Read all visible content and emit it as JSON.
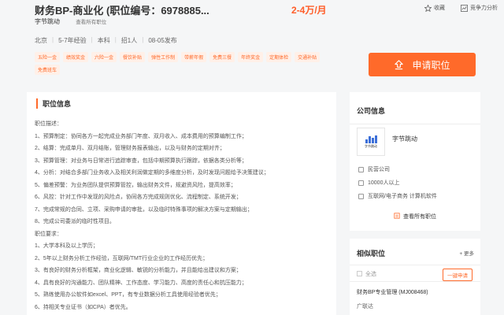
{
  "header": {
    "title": "财务BP-商业化 (职位编号：6978885...",
    "salary": "2-4万/月",
    "actions": [
      {
        "label": "收藏",
        "icon": "star-icon"
      },
      {
        "label": "竞争力分析",
        "icon": "analysis-icon"
      }
    ],
    "company": "字节跳动",
    "company_link": "查看所有职位",
    "meta": [
      "北京",
      "5-7年经验",
      "本科",
      "招1人",
      "08-05发布"
    ],
    "tags": [
      "五险一金",
      "绩效奖金",
      "六险一金",
      "餐饮补贴",
      "弹性工作制",
      "带薪年假",
      "免费三餐",
      "年终奖金",
      "定期体检",
      "交通补贴",
      "免费班车"
    ],
    "apply_label": "申请职位"
  },
  "job": {
    "section_title": "职位信息",
    "lines": [
      "职位描述：",
      "1、预算制定：协同各方一起完成业务部门年度、双月收入、成本费用的预算编制工作；",
      "2、结算：完成单月、双月结账，管理财务报表输出，以及与财务的定期对齐；",
      "3、预算管理：对业务与日常进行追踪审查，包括中期预算执行跟踪，依据各类分析等；",
      "4、分析：对结合多部门业务收入及相关利润做定期的多维度分析，及时发现问题给予决策建议；",
      "5、偏差预警：为业务团队提供预算管控，输出财务文件，规避资风险，提高效率；",
      "6、风控：针对工作中发现的风险点，协同各方完成规则优化、流程制定、系统开发；",
      "7、完成常规的合同、立项、采购申请的审批，以及临时特殊事项的解决方案与定期输出；",
      "8、完成公司委派的临时性项目。",
      "职位要求：",
      "1、大学本科及以上学历；",
      "2、5年以上财务分析工作经验，互联网/TMT行业企业的工作经历优先；",
      "3、有良好的财务分析框架，商业化逻辑、敏锐的分析能力，并且能给出建议和方案；",
      "4、具有良好的沟通能力、团队精神、工作态度、学习能力、高度的责任心和抗压能力；",
      "5、熟练使用办公软件如excel、PPT，有专业数据分析工具使用经验者优先；",
      "6、持相关专业证书（如CPA）者优先。"
    ]
  },
  "company_card": {
    "title": "公司信息",
    "name": "字节跳动",
    "logo_text": "字节跳动",
    "info": [
      "民营公司",
      "10000人以上",
      "互联网/电子商务 计算机软件"
    ],
    "see_jobs": "查看所有职位"
  },
  "similar": {
    "title": "相似职位",
    "more": "+ 更多",
    "select_all": "全选",
    "apply_label": "一键申请",
    "job_title": "财务BP专业管理 (MJ008468)",
    "job_location": "广联达"
  },
  "colors": {
    "accent": "#ff6a2a",
    "salary": "#ff5e2a",
    "tag_bg": "#fff0e8"
  }
}
